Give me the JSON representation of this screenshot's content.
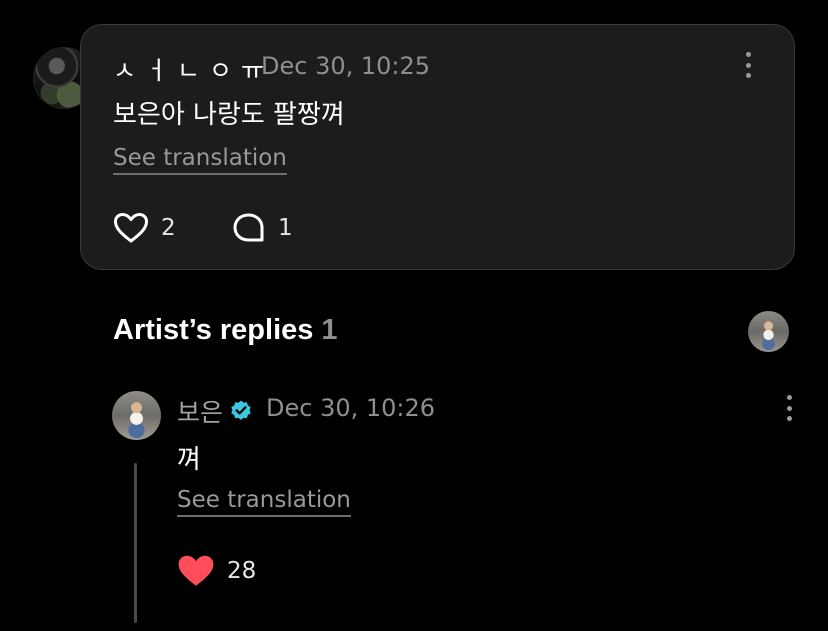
{
  "comment": {
    "author": "ㅅㅓㄴㅇㅠ",
    "date": "Dec 30, 10:25",
    "text": "보은아 나랑도 팔짱껴",
    "see_translation": "See translation",
    "likes": "2",
    "replies": "1",
    "menu_icon": "more-vertical-icon",
    "like_icon": "heart-outline-icon",
    "reply_icon": "comment-bubble-icon"
  },
  "artist_replies": {
    "title": "Artist’s replies",
    "count": "1",
    "reply": {
      "author": "보은",
      "verified_icon": "verified-badge-icon",
      "date": "Dec 30, 10:26",
      "text": "껴",
      "see_translation": "See translation",
      "likes": "28",
      "like_icon": "heart-filled-icon",
      "menu_icon": "more-vertical-icon"
    }
  },
  "colors": {
    "background": "#000000",
    "card": "#1c1c1e",
    "muted_text": "#8e8e93",
    "verified": "#3ec7e0",
    "heart_filled": "#ff4d5b"
  }
}
